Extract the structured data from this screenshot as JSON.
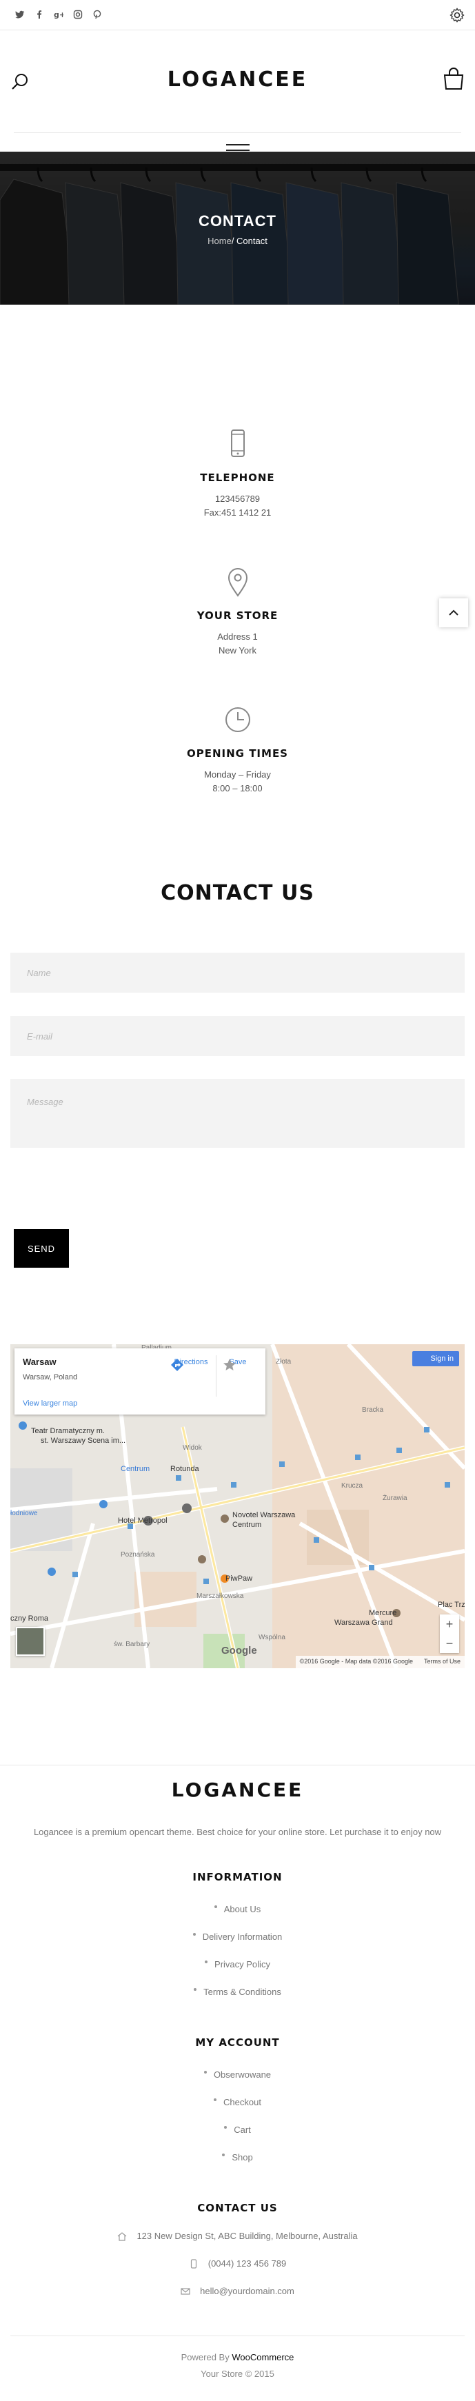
{
  "socials": [
    "twitter-icon",
    "facebook-icon",
    "google-plus-icon",
    "instagram-icon",
    "pinterest-icon"
  ],
  "brand": {
    "logo": "LOGANCEE"
  },
  "banner": {
    "title": "CONTACT",
    "crumb_home": "Home",
    "crumb_sep": "/ ",
    "crumb_current": "Contact"
  },
  "contact_info": {
    "telephone": {
      "title": "TELEPHONE",
      "line1": "123456789",
      "line2": "Fax:451 1412 21"
    },
    "store": {
      "title": "YOUR STORE",
      "line1": "Address 1",
      "line2": "New York"
    },
    "hours": {
      "title": "OPENING TIMES",
      "line1": "Monday – Friday",
      "line2": "8:00 – 18:00"
    }
  },
  "form": {
    "title": "CONTACT US",
    "name_placeholder": "Name",
    "email_placeholder": "E-mail",
    "message_placeholder": "Message",
    "send_label": "SEND"
  },
  "map": {
    "place": "Warsaw",
    "address": "Warsaw, Poland",
    "larger_map": "View larger map",
    "directions": "Directions",
    "save": "Save",
    "sign_in": "Sign in",
    "google": "Google",
    "attribution": "©2016 Google - Map data ©2016 Google",
    "terms": "Terms of Use",
    "labels": {
      "teatr": "Teatr Dramatyczny m.",
      "teatr2": "st. Warszawy Scena im...",
      "centrum": "Centrum",
      "rotunda": "Rotunda",
      "metropol": "Hotel Metropol",
      "novotel": "Novotel Warszawa",
      "novotel2": "Centrum",
      "piwpaw": "PiwPaw",
      "mercure": "Mercure",
      "mercure2": "Warszawa Grand",
      "roma": "czny Roma",
      "plac": "Plac Trze",
      "zlota": "Złota",
      "widok": "Widok",
      "zurawia": "Żurawia",
      "wspolna": "Wspólna",
      "barbary": "św. Barbary",
      "bracka": "Bracka",
      "krucza": "Krucza",
      "poznanska": "Poznańska",
      "marszalkowska": "Marszałkowska",
      "badiwie": "łodniowe",
      "pallad": "Palladium"
    }
  },
  "footer": {
    "logo": "LOGANCEE",
    "tagline": "Logancee is a premium opencart theme. Best choice for your online store. Let purchase it to enjoy now",
    "information": {
      "title": "INFORMATION",
      "links": [
        "About Us",
        "Delivery Information",
        "Privacy Policy",
        "Terms & Conditions"
      ]
    },
    "account": {
      "title": "MY ACCOUNT",
      "links": [
        "Obserwowane",
        "Checkout",
        "Cart",
        "Shop"
      ]
    },
    "contact": {
      "title": "CONTACT US",
      "address": "123 New Design St, ABC Building, Melbourne, Australia",
      "phone": "(0044) 123 456 789",
      "email": "hello@yourdomain.com"
    },
    "powered_prefix": "Powered By",
    "powered_brand": "WooCommerce",
    "copyright": "Your Store © 2015"
  }
}
